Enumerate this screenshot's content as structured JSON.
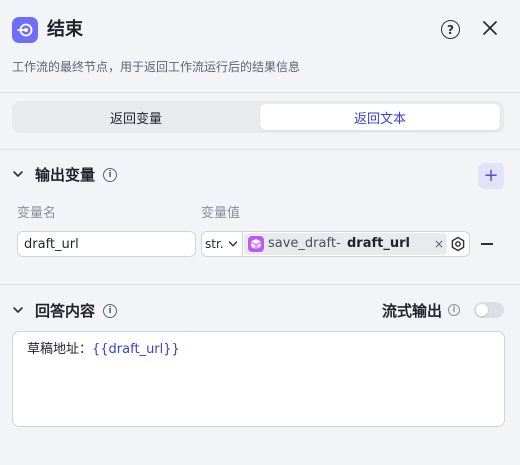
{
  "header": {
    "title": "结束",
    "description": "工作流的最终节点，用于返回工作流运行后的结果信息",
    "icons": {
      "node": "end-node-icon",
      "help": "help-icon",
      "close": "close-icon"
    },
    "help_glyph": "?"
  },
  "tabs": [
    {
      "label": "返回变量",
      "selected": false
    },
    {
      "label": "返回文本",
      "selected": true
    }
  ],
  "output_section": {
    "title": "输出变量",
    "add_glyph": "+",
    "columns": {
      "name": "变量名",
      "value": "变量值"
    },
    "rows": [
      {
        "name": "draft_url",
        "type": "str.",
        "reference": {
          "node": "save_draft",
          "separator": "-",
          "variable": "draft_url"
        },
        "remove_glyph": "×"
      }
    ]
  },
  "answer_section": {
    "title": "回答内容",
    "stream_label": "流式输出",
    "stream_enabled": false,
    "content_prefix": "草稿地址：",
    "content_variable": "{{draft_url}}"
  },
  "colors": {
    "accent": "#3a3fd8",
    "node_icon_bg": "#6e6ff7",
    "ref_icon_bg": "#b85cf5",
    "panel_bg": "#f3f4f7"
  }
}
